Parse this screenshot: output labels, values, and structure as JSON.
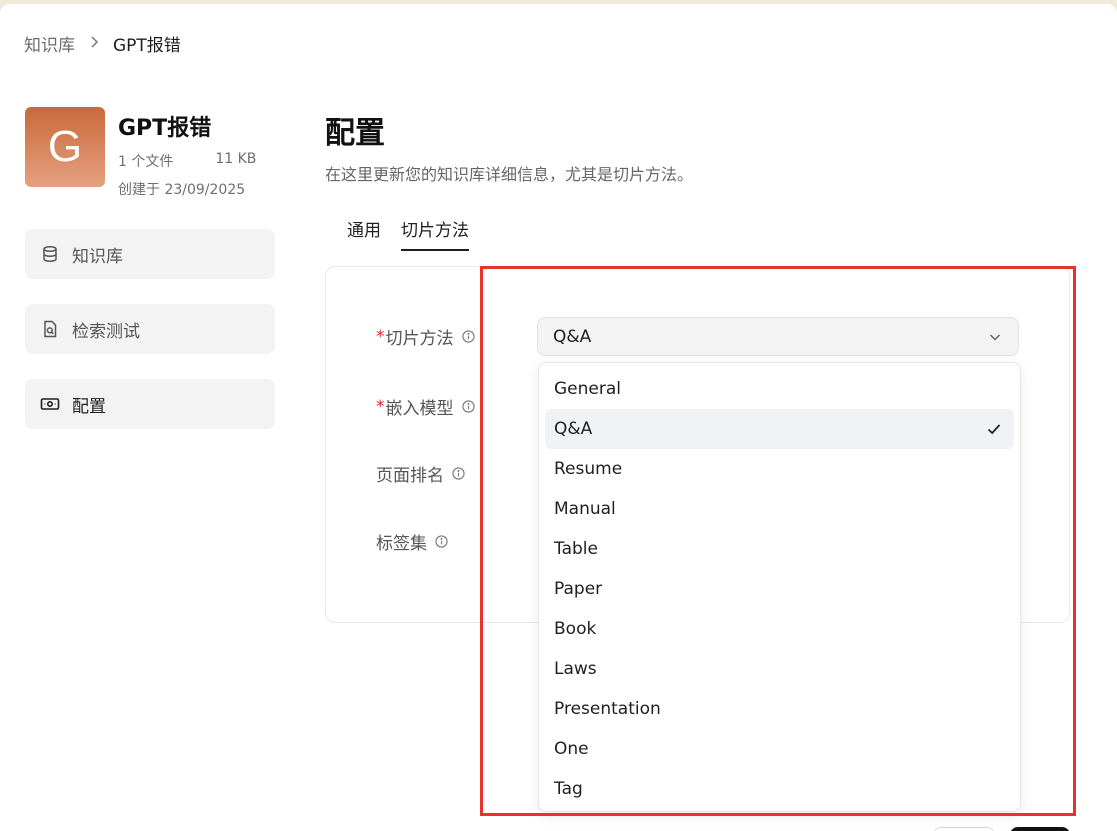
{
  "breadcrumb": {
    "root": "知识库",
    "current": "GPT报错"
  },
  "kb": {
    "avatar_letter": "G",
    "name": "GPT报错",
    "file_count": "1 个文件",
    "size": "11 KB",
    "created": "创建于 23/09/2025"
  },
  "sidebar": {
    "items": [
      {
        "label": "知识库",
        "icon": "database-icon"
      },
      {
        "label": "检索测试",
        "icon": "file-search-icon"
      },
      {
        "label": "配置",
        "icon": "banknote-icon"
      }
    ]
  },
  "main": {
    "title": "配置",
    "description": "在这里更新您的知识库详细信息，尤其是切片方法。",
    "tabs": [
      {
        "label": "通用"
      },
      {
        "label": "切片方法"
      }
    ]
  },
  "form": {
    "fields": [
      {
        "label": "切片方法",
        "required": "*"
      },
      {
        "label": "嵌入模型",
        "required": "*"
      },
      {
        "label": "页面排名"
      },
      {
        "label": "标签集"
      }
    ],
    "chunk_method": {
      "value": "Q&A",
      "options": [
        "General",
        "Q&A",
        "Resume",
        "Manual",
        "Table",
        "Paper",
        "Book",
        "Laws",
        "Presentation",
        "One",
        "Tag"
      ]
    }
  },
  "colors": {
    "accent_highlight": "#e8332b",
    "required_star": "#e0262a",
    "avatar_top": "#c86a3a",
    "avatar_bottom": "#e6a07e"
  }
}
